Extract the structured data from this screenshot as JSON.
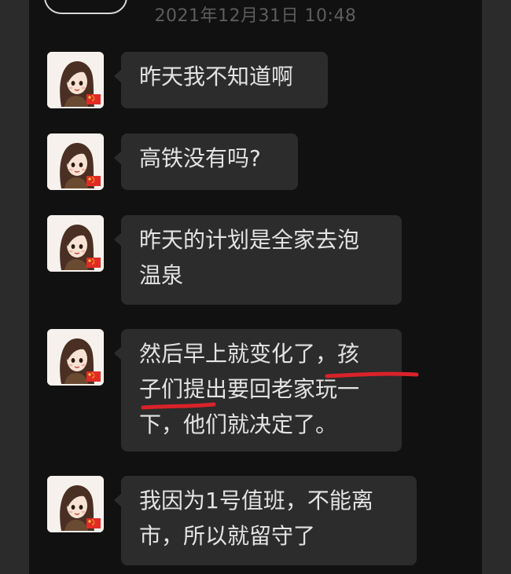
{
  "header": {
    "timestamp": "2021年12月31日 10:48"
  },
  "sender": {
    "avatar_icon": "cartoon-girl-avatar-icon",
    "flag_icon": "flag-badge-icon"
  },
  "messages": [
    {
      "lines": [
        "昨天我不知道啊"
      ]
    },
    {
      "lines": [
        "高铁没有吗?"
      ]
    },
    {
      "lines": [
        "昨天的计划是全家去泡",
        "温泉"
      ]
    },
    {
      "lines": [
        "然后早上就变化了，孩",
        "子们提出要回老家玩一",
        "下，他们就决定了。"
      ]
    },
    {
      "lines": [
        "我因为1号值班，不能离",
        "市，所以就留守了"
      ]
    }
  ],
  "colors": {
    "background": "#2b2b2b",
    "chat_panel": "#111111",
    "bubble": "#2c2c2c",
    "bubble_text": "#e3e3e3",
    "timestamp_text": "#5d5d5d",
    "annotation_underline": "#d9222a"
  }
}
